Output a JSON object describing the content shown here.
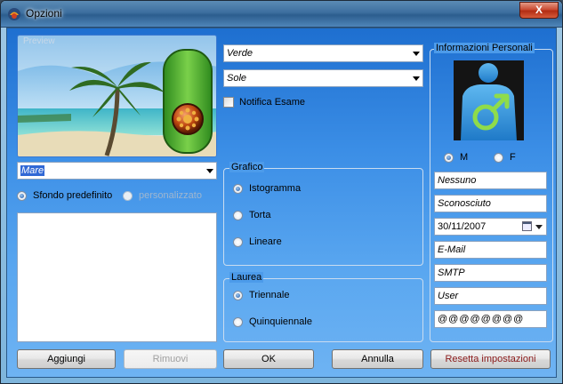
{
  "window": {
    "title": "Opzioni",
    "close_label": "X"
  },
  "preview": {
    "label": "Preview"
  },
  "dropdowns": {
    "theme": "Verde",
    "icon": "Sole",
    "background": "Mare"
  },
  "exam_notify": {
    "label": "Notifica Esame",
    "checked": false
  },
  "background_mode": {
    "default_label": "Sfondo predefinito",
    "custom_label": "personalizzato",
    "selected": "default"
  },
  "chart_group": {
    "title": "Grafico",
    "options": [
      "Istogramma",
      "Torta",
      "Lineare"
    ],
    "selected": "Istogramma"
  },
  "degree_group": {
    "title": "Laurea",
    "options": [
      "Triennale",
      "Quinquiennale"
    ],
    "selected": "Triennale"
  },
  "personal": {
    "title": "Informazioni Personali",
    "gender_m": "M",
    "gender_f": "F",
    "gender_selected": "M",
    "name": "Nessuno",
    "surname": "Sconosciuto",
    "birthdate": "30/11/2007",
    "email": "E-Mail",
    "smtp": "SMTP",
    "user": "User",
    "password": "@@@@@@@@"
  },
  "buttons": {
    "add": "Aggiungi",
    "remove": "Rimuovi",
    "ok": "OK",
    "cancel": "Annulla",
    "reset": "Resetta impostazioni"
  },
  "colors": {
    "panel_top": "#1e6fd0",
    "panel_bottom": "#6eb3f3",
    "avatar_blue": "#2f8fd8",
    "gender_green": "#8fdc4a"
  },
  "icons": {
    "app": "app-icon",
    "close": "close-icon",
    "calendar": "calendar-icon",
    "male": "male-symbol-icon"
  }
}
